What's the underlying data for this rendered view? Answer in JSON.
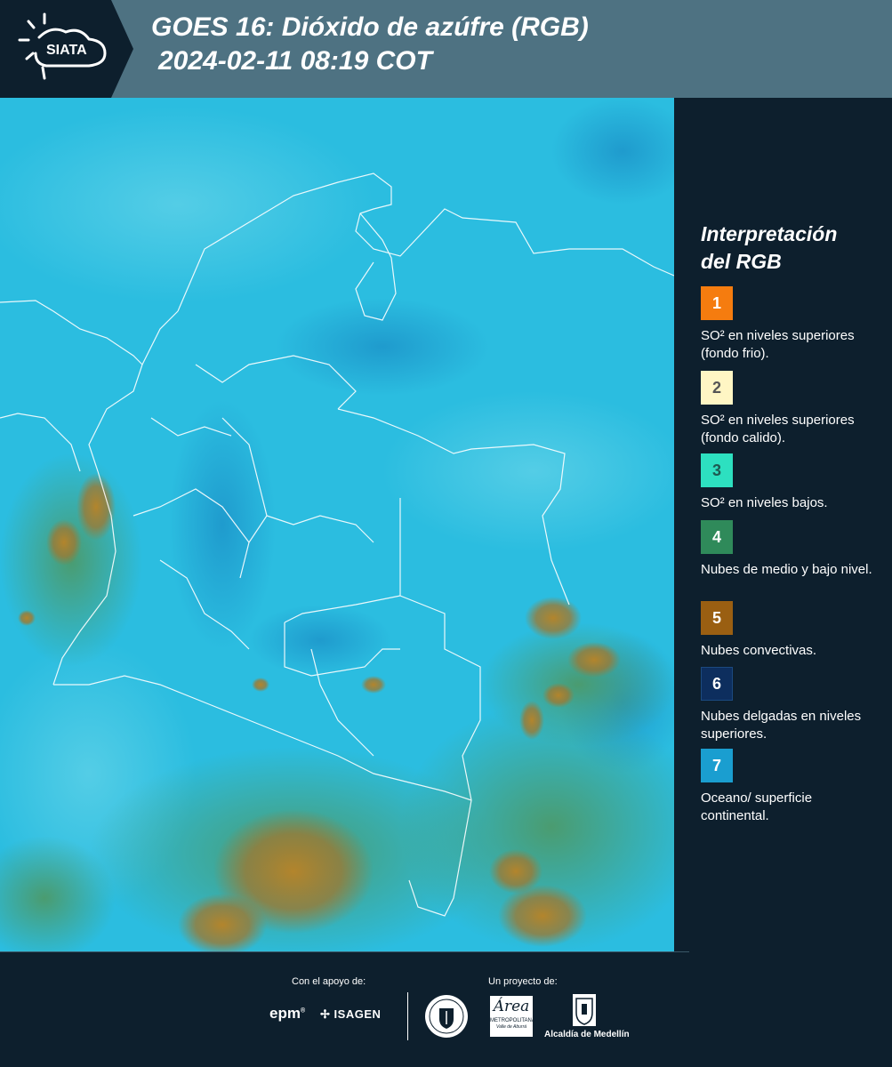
{
  "header": {
    "logo_text": "SIATA",
    "title_line1": "GOES 16: Dióxido de azúfre (RGB)",
    "title_line2": "2024-02-11 08:19 COT"
  },
  "legend": {
    "title_line1": "Interpretación",
    "title_line2": "del RGB",
    "items": [
      {
        "number": "1",
        "color": "#f57c0f",
        "text_color": "#ffffff",
        "text": "SO² en niveles superiores (fondo frio)."
      },
      {
        "number": "2",
        "color": "#fff6c4",
        "text_color": "#555555",
        "text": "SO² en niveles superiores (fondo calido)."
      },
      {
        "number": "3",
        "color": "#2de0c0",
        "text_color": "#1d5a50",
        "text": "SO² en niveles bajos."
      },
      {
        "number": "4",
        "color": "#2f8a5a",
        "text_color": "#ffffff",
        "text": "Nubes de medio y bajo nivel."
      },
      {
        "number": "5",
        "color": "#9a5f12",
        "text_color": "#ffffff",
        "text": "Nubes convectivas."
      },
      {
        "number": "6",
        "color": "#0d2e5e",
        "text_color": "#ffffff",
        "text": "Nubes delgadas en niveles superiores."
      },
      {
        "number": "7",
        "color": "#1a9ed0",
        "text_color": "#ffffff",
        "text": "Oceano/ superficie continental."
      }
    ]
  },
  "footer": {
    "support_caption": "Con el apoyo de:",
    "project_caption": "Un proyecto de:",
    "sponsor_epm": "epm",
    "sponsor_isagen": "ISAGEN",
    "area_metro_name": "Área",
    "area_metro_sub1": "METROPOLITANA",
    "area_metro_sub2": "Valle de Aburrá",
    "alcaldia": "Alcaldía de Medellín"
  },
  "colors": {
    "header_bg": "#4e7282",
    "panel_bg": "#0d1f2d",
    "map_base": "#2bbde0"
  }
}
